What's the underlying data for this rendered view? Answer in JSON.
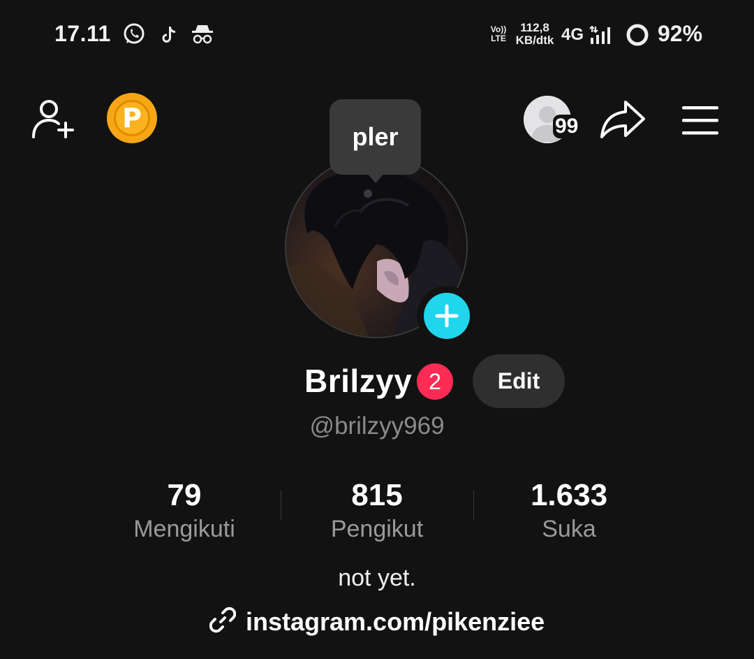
{
  "status_bar": {
    "time": "17.11",
    "notification_icons": [
      "whatsapp-icon",
      "tiktok-icon",
      "incognito-icon"
    ],
    "volte_label": "Vo))\nLTE",
    "speed_value": "112,8",
    "speed_unit": "KB/dtk",
    "network": "4G",
    "battery": "92%"
  },
  "top_bar": {
    "coin_letter": "P",
    "visitor_count": "99"
  },
  "profile": {
    "tooltip": "pler",
    "display_name": "Brilzyy",
    "notification_badge": "2",
    "edit_label": "Edit",
    "username": "@brilzyy969"
  },
  "stats": [
    {
      "value": "79",
      "label": "Mengikuti"
    },
    {
      "value": "815",
      "label": "Pengikut"
    },
    {
      "value": "1.633",
      "label": "Suka"
    }
  ],
  "bio": {
    "text": "not yet.",
    "link": "instagram.com/pikenziee"
  },
  "colors": {
    "background": "#121212",
    "accent_cyan": "#20d5ec",
    "badge_red": "#fe2c55",
    "coin_orange": "#f7a716"
  }
}
